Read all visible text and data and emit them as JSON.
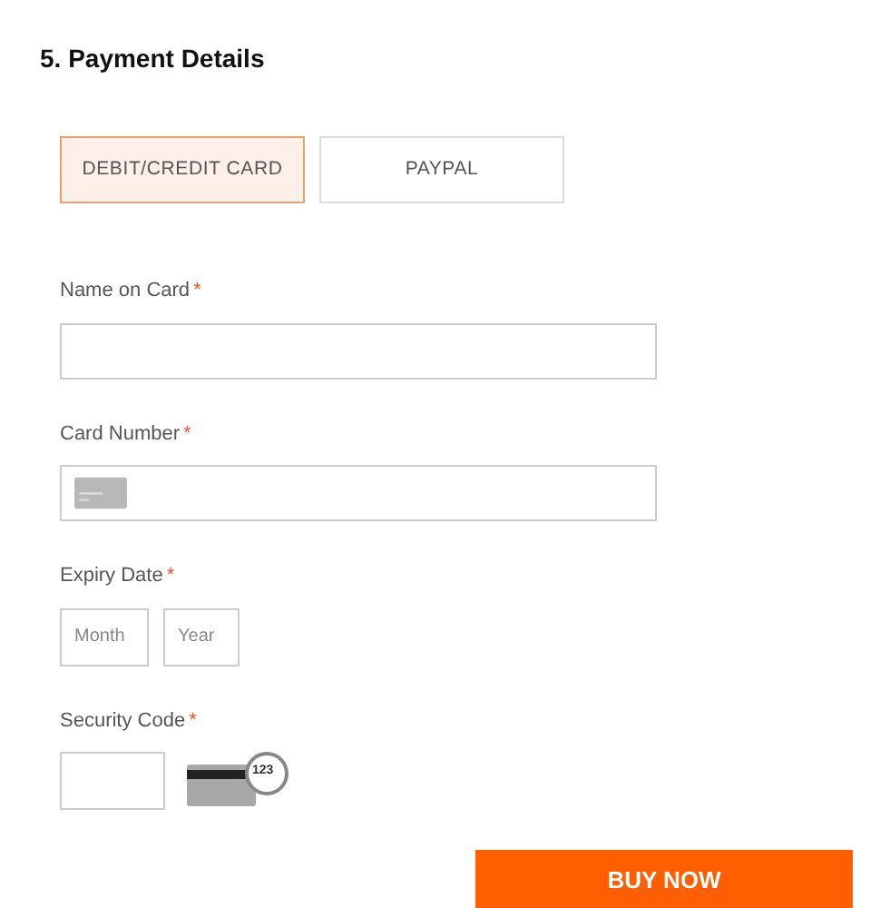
{
  "heading": "5. Payment Details",
  "tabs": [
    {
      "label": "DEBIT/CREDIT CARD",
      "selected": true
    },
    {
      "label": "PAYPAL",
      "selected": false
    }
  ],
  "fields": [
    {
      "kind": "text",
      "label": "Name on Card",
      "required_mark": "*"
    },
    {
      "kind": "card",
      "label": "Card Number",
      "required_mark": "*"
    },
    {
      "kind": "expiry",
      "label": "Expiry Date",
      "required_mark": "*",
      "inputs": [
        {
          "placeholder": "Month"
        },
        {
          "placeholder": "Year"
        }
      ]
    },
    {
      "kind": "cvv",
      "label": "Security Code",
      "required_mark": "*",
      "hint": "123"
    }
  ],
  "submit": "BUY NOW"
}
